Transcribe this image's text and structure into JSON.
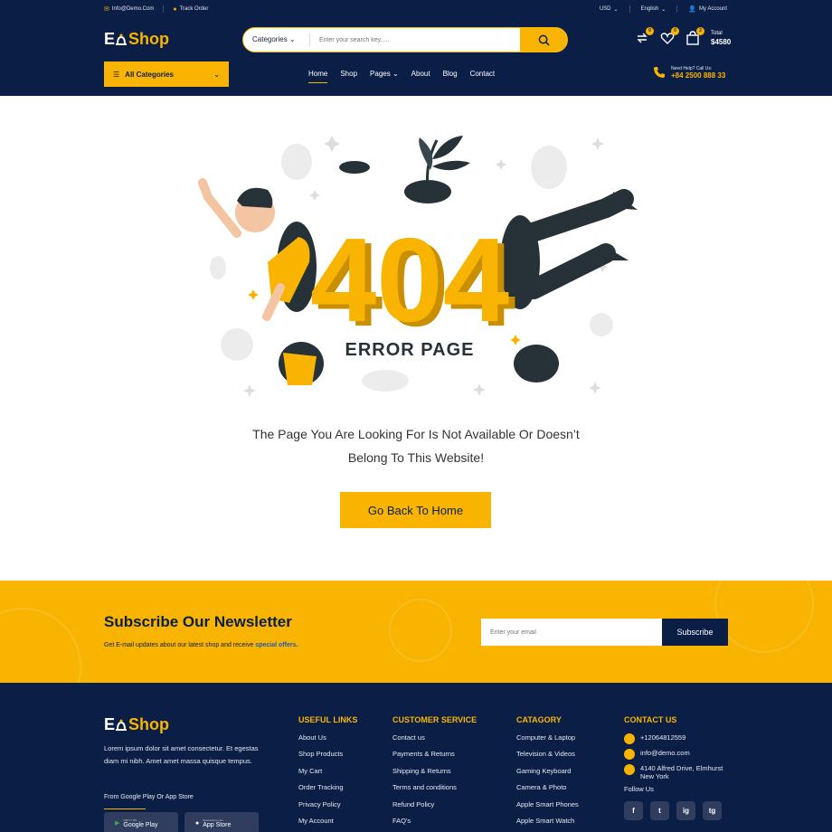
{
  "topbar": {
    "email": "Info@Demo.Com",
    "track_order": "Track Order",
    "currency": "USD",
    "language": "English",
    "account": "My Account"
  },
  "header": {
    "logo_part1": "E",
    "logo_part2": "Shop",
    "search_category": "Categories",
    "search_placeholder": "Enter your search key.....",
    "compare_count": "0",
    "wishlist_count": "0",
    "cart_count": "2",
    "total_label": "Total",
    "total_value": "$4580",
    "all_categories": "All Categories",
    "nav": [
      "Home",
      "Shop",
      "Pages",
      "About",
      "Blog",
      "Contact"
    ],
    "help_label": "Need Help? Call Us:",
    "help_phone": "+84 2500 888 33"
  },
  "main": {
    "error_number": "404",
    "error_title": "ERROR PAGE",
    "message_line1": "The Page You Are Looking For Is Not Available Or Doesn’t",
    "message_line2": "Belong To This Website!",
    "button": "Go Back To Home"
  },
  "newsletter": {
    "title": "Subscribe Our Newsletter",
    "text": "Get E-mail updates about our latest shop and receive",
    "highlight": "special offers.",
    "placeholder": "Enter your email",
    "button": "Subscribe"
  },
  "footer": {
    "desc": "Lorem ipsum dolor sit amet consectetur. Et egestas diam mi nibh. Amet amet massa quisque tempus.",
    "app_label": "From Google Play Or App Store",
    "google_small": "GET IT ON",
    "google": "Google Play",
    "apple_small": "Download on the",
    "apple": "App Store",
    "useful_title": "USEFUL LINKS",
    "useful": [
      "About Us",
      "Shop Products",
      "My Cart",
      "Order Tracking",
      "Privacy Policy",
      "My Account"
    ],
    "service_title": "CUSTOMER SERVICE",
    "service": [
      "Contact us",
      "Payments & Returns",
      "Shipping & Returns",
      "Terms and conditions",
      "Refund Policy",
      "FAQ's"
    ],
    "category_title": "CATAGORY",
    "category": [
      "Computer & Laptop",
      "Television & Videos",
      "Gaming Keyboard",
      "Camera & Photo",
      "Apple Smart Phones",
      "Apple Smart Watch"
    ],
    "contact_title": "CONTACT US",
    "phone": "+12064812559",
    "email": "info@demo.com",
    "address1": "4140 Alfred Drive, Elmhurst",
    "address2": "New York",
    "follow": "Follow Us",
    "social": [
      "f",
      "t",
      "ig",
      "tg"
    ]
  },
  "colors": {
    "navy": "#0b1e46",
    "accent": "#f8b400"
  }
}
